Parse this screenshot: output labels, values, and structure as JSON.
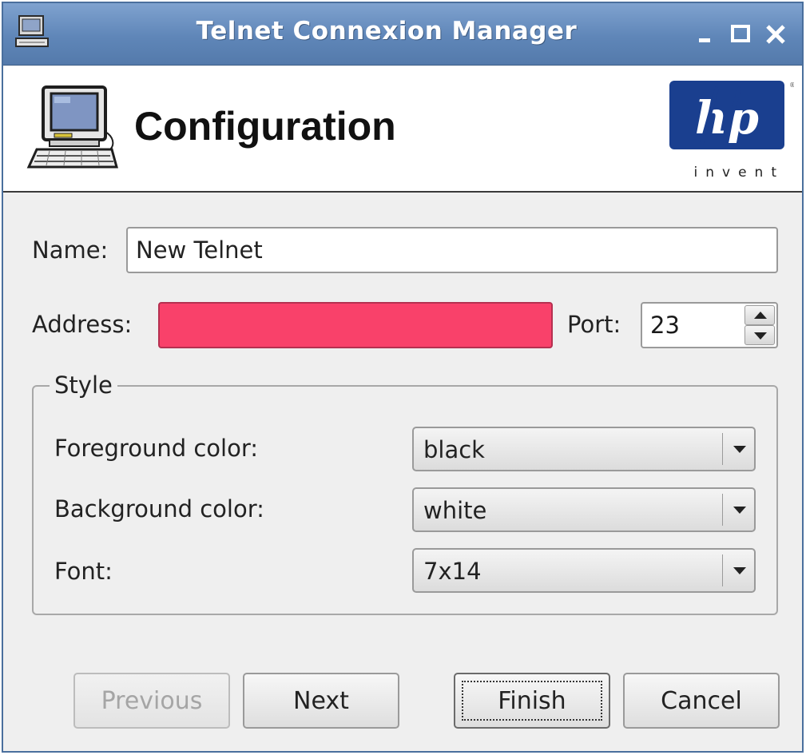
{
  "window": {
    "title": "Telnet Connexion Manager"
  },
  "header": {
    "title": "Configuration",
    "logo_tagline": "invent"
  },
  "form": {
    "name_label": "Name:",
    "name_value": "New Telnet",
    "address_label": "Address:",
    "address_value": "",
    "address_error_color": "#f9416a",
    "port_label": "Port:",
    "port_value": "23"
  },
  "style": {
    "legend": "Style",
    "foreground_label": "Foreground color:",
    "foreground_value": "black",
    "background_label": "Background color:",
    "background_value": "white",
    "font_label": "Font:",
    "font_value": "7x14"
  },
  "buttons": {
    "previous": "Previous",
    "next": "Next",
    "finish": "Finish",
    "cancel": "Cancel"
  },
  "colors": {
    "titlebar": "#5f86b8",
    "hp_blue": "#1a3f8f"
  }
}
